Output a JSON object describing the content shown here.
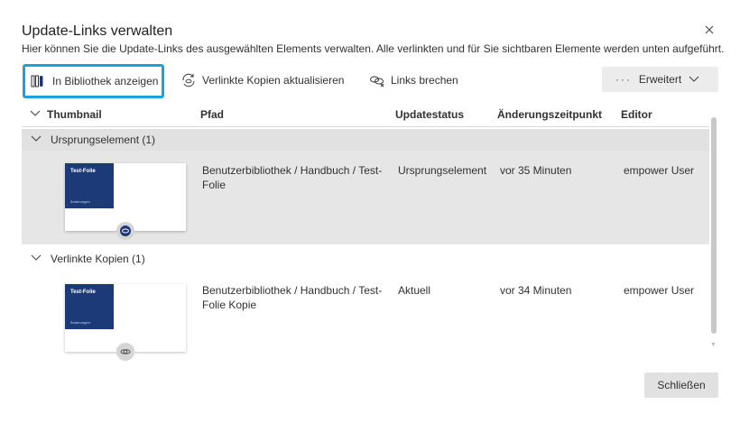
{
  "dialog": {
    "title": "Update-Links verwalten",
    "subtitle": "Hier können Sie die Update-Links des ausgewählten Elements verwalten. Alle verlinkten und für Sie sichtbaren Elemente werden unten aufgeführt."
  },
  "toolbar": {
    "show_in_library": "In Bibliothek anzeigen",
    "update_linked": "Verlinkte Kopien aktualisieren",
    "break_links": "Links brechen",
    "advanced": "Erweitert",
    "highlight_color": "#1aa4d6"
  },
  "table": {
    "columns": [
      "Thumbnail",
      "Pfad",
      "Updatestatus",
      "Änderungszeitpunkt",
      "Editor"
    ],
    "groups": [
      {
        "label": "Ursprungselement (1)",
        "rows": [
          {
            "thumb_title": "Test-Folie",
            "thumb_sub": "Änderungen",
            "path_line1": "Benutzerbibliothek / Handbuch / Test-",
            "path_line2": "Folie",
            "status": "Ursprungselement",
            "changed": "vor 35 Minuten",
            "editor": "empower User"
          }
        ]
      },
      {
        "label": "Verlinkte Kopien (1)",
        "rows": [
          {
            "thumb_title": "Test-Folie",
            "thumb_sub": "Änderungen",
            "path_line1": "Benutzerbibliothek / Handbuch / Test-",
            "path_line2": "Folie Kopie",
            "status": "Aktuell",
            "changed": "vor 34 Minuten",
            "editor": "empower User"
          }
        ]
      }
    ]
  },
  "footer": {
    "close_label": "Schließen"
  },
  "colors": {
    "slide_blue": "#1d3a78",
    "selected_row": "#e6e6e6"
  }
}
